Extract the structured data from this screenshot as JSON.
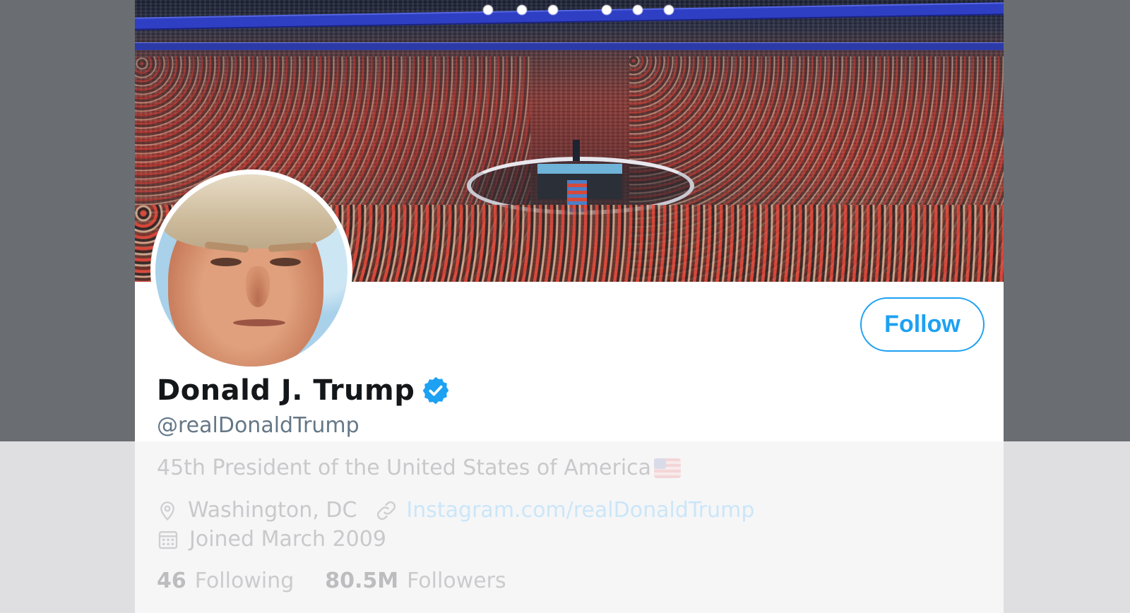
{
  "profile": {
    "display_name": "Donald J. Trump",
    "handle": "@realDonaldTrump",
    "verified": true,
    "bio": "45th President of the United States of America",
    "location": "Washington, DC",
    "website": "Instagram.com/realDonaldTrump",
    "joined": "Joined March 2009",
    "following_count": "46",
    "following_label": "Following",
    "followers_count": "80.5M",
    "followers_label": "Followers"
  },
  "actions": {
    "follow_label": "Follow"
  },
  "icons": {
    "verified": "verified-badge-icon",
    "flag": "us-flag-icon",
    "location": "location-pin-icon",
    "link": "link-icon",
    "calendar": "calendar-icon"
  },
  "colors": {
    "accent": "#1da1f2",
    "text_primary": "#14171a",
    "text_secondary": "#657786"
  }
}
